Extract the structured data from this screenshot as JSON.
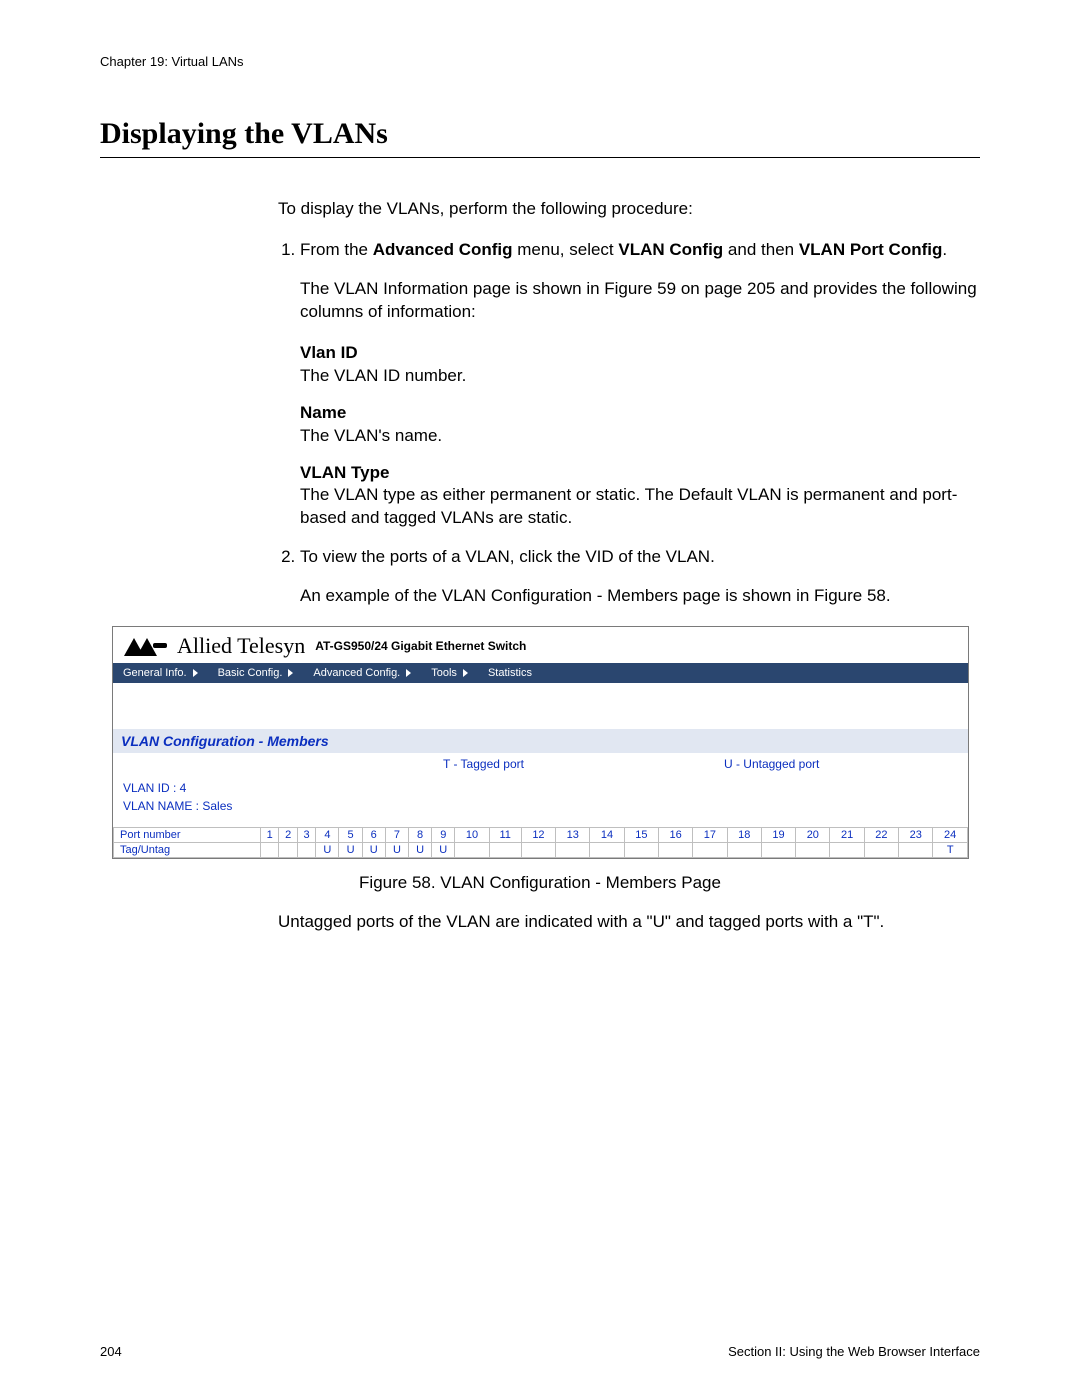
{
  "header": {
    "chapter": "Chapter 19: Virtual LANs"
  },
  "title": "Displaying the VLANs",
  "body": {
    "intro": "To display the VLANs, perform the following procedure:",
    "step1_a": "From the ",
    "step1_b": "Advanced Config",
    "step1_c": " menu, select ",
    "step1_d": "VLAN Config",
    "step1_e": " and then ",
    "step1_f": "VLAN Port Config",
    "step1_g": ".",
    "step1_para": "The VLAN Information page is shown in Figure 59 on page 205 and provides the following columns of information:",
    "defs": [
      {
        "term": "Vlan ID",
        "desc": "The VLAN ID number."
      },
      {
        "term": "Name",
        "desc": "The VLAN's name."
      },
      {
        "term": "VLAN Type",
        "desc": "The VLAN type as either permanent or static. The Default VLAN is permanent and port-based and tagged VLANs are static."
      }
    ],
    "step2": "To view the ports of a VLAN, click the VID of the VLAN.",
    "step2_para": "An example of the VLAN Configuration - Members page is shown in Figure 58.",
    "figure_caption": "Figure 58. VLAN Configuration - Members Page",
    "closing": "Untagged ports of the VLAN are indicated with a \"U\" and tagged ports with a \"T\"."
  },
  "figure": {
    "brand": "Allied Telesyn",
    "model": "AT-GS950/24 Gigabit Ethernet Switch",
    "menu": [
      "General Info.",
      "Basic Config.",
      "Advanced Config.",
      "Tools",
      "Statistics"
    ],
    "panel_title": "VLAN Configuration - Members",
    "legend_tagged": "T - Tagged port",
    "legend_untagged": "U - Untagged port",
    "vlan_id_label": "VLAN ID : 4",
    "vlan_name_label": "VLAN NAME : Sales",
    "row1_label": "Port number",
    "row2_label": "Tag/Untag",
    "ports": [
      "1",
      "2",
      "3",
      "4",
      "5",
      "6",
      "7",
      "8",
      "9",
      "10",
      "11",
      "12",
      "13",
      "14",
      "15",
      "16",
      "17",
      "18",
      "19",
      "20",
      "21",
      "22",
      "23",
      "24"
    ],
    "tags": [
      "",
      "",
      "",
      "U",
      "U",
      "U",
      "U",
      "U",
      "U",
      "",
      "",
      "",
      "",
      "",
      "",
      "",
      "",
      "",
      "",
      "",
      "",
      "",
      "",
      "T"
    ]
  },
  "footer": {
    "page_number": "204",
    "section": "Section II: Using the Web Browser Interface"
  }
}
